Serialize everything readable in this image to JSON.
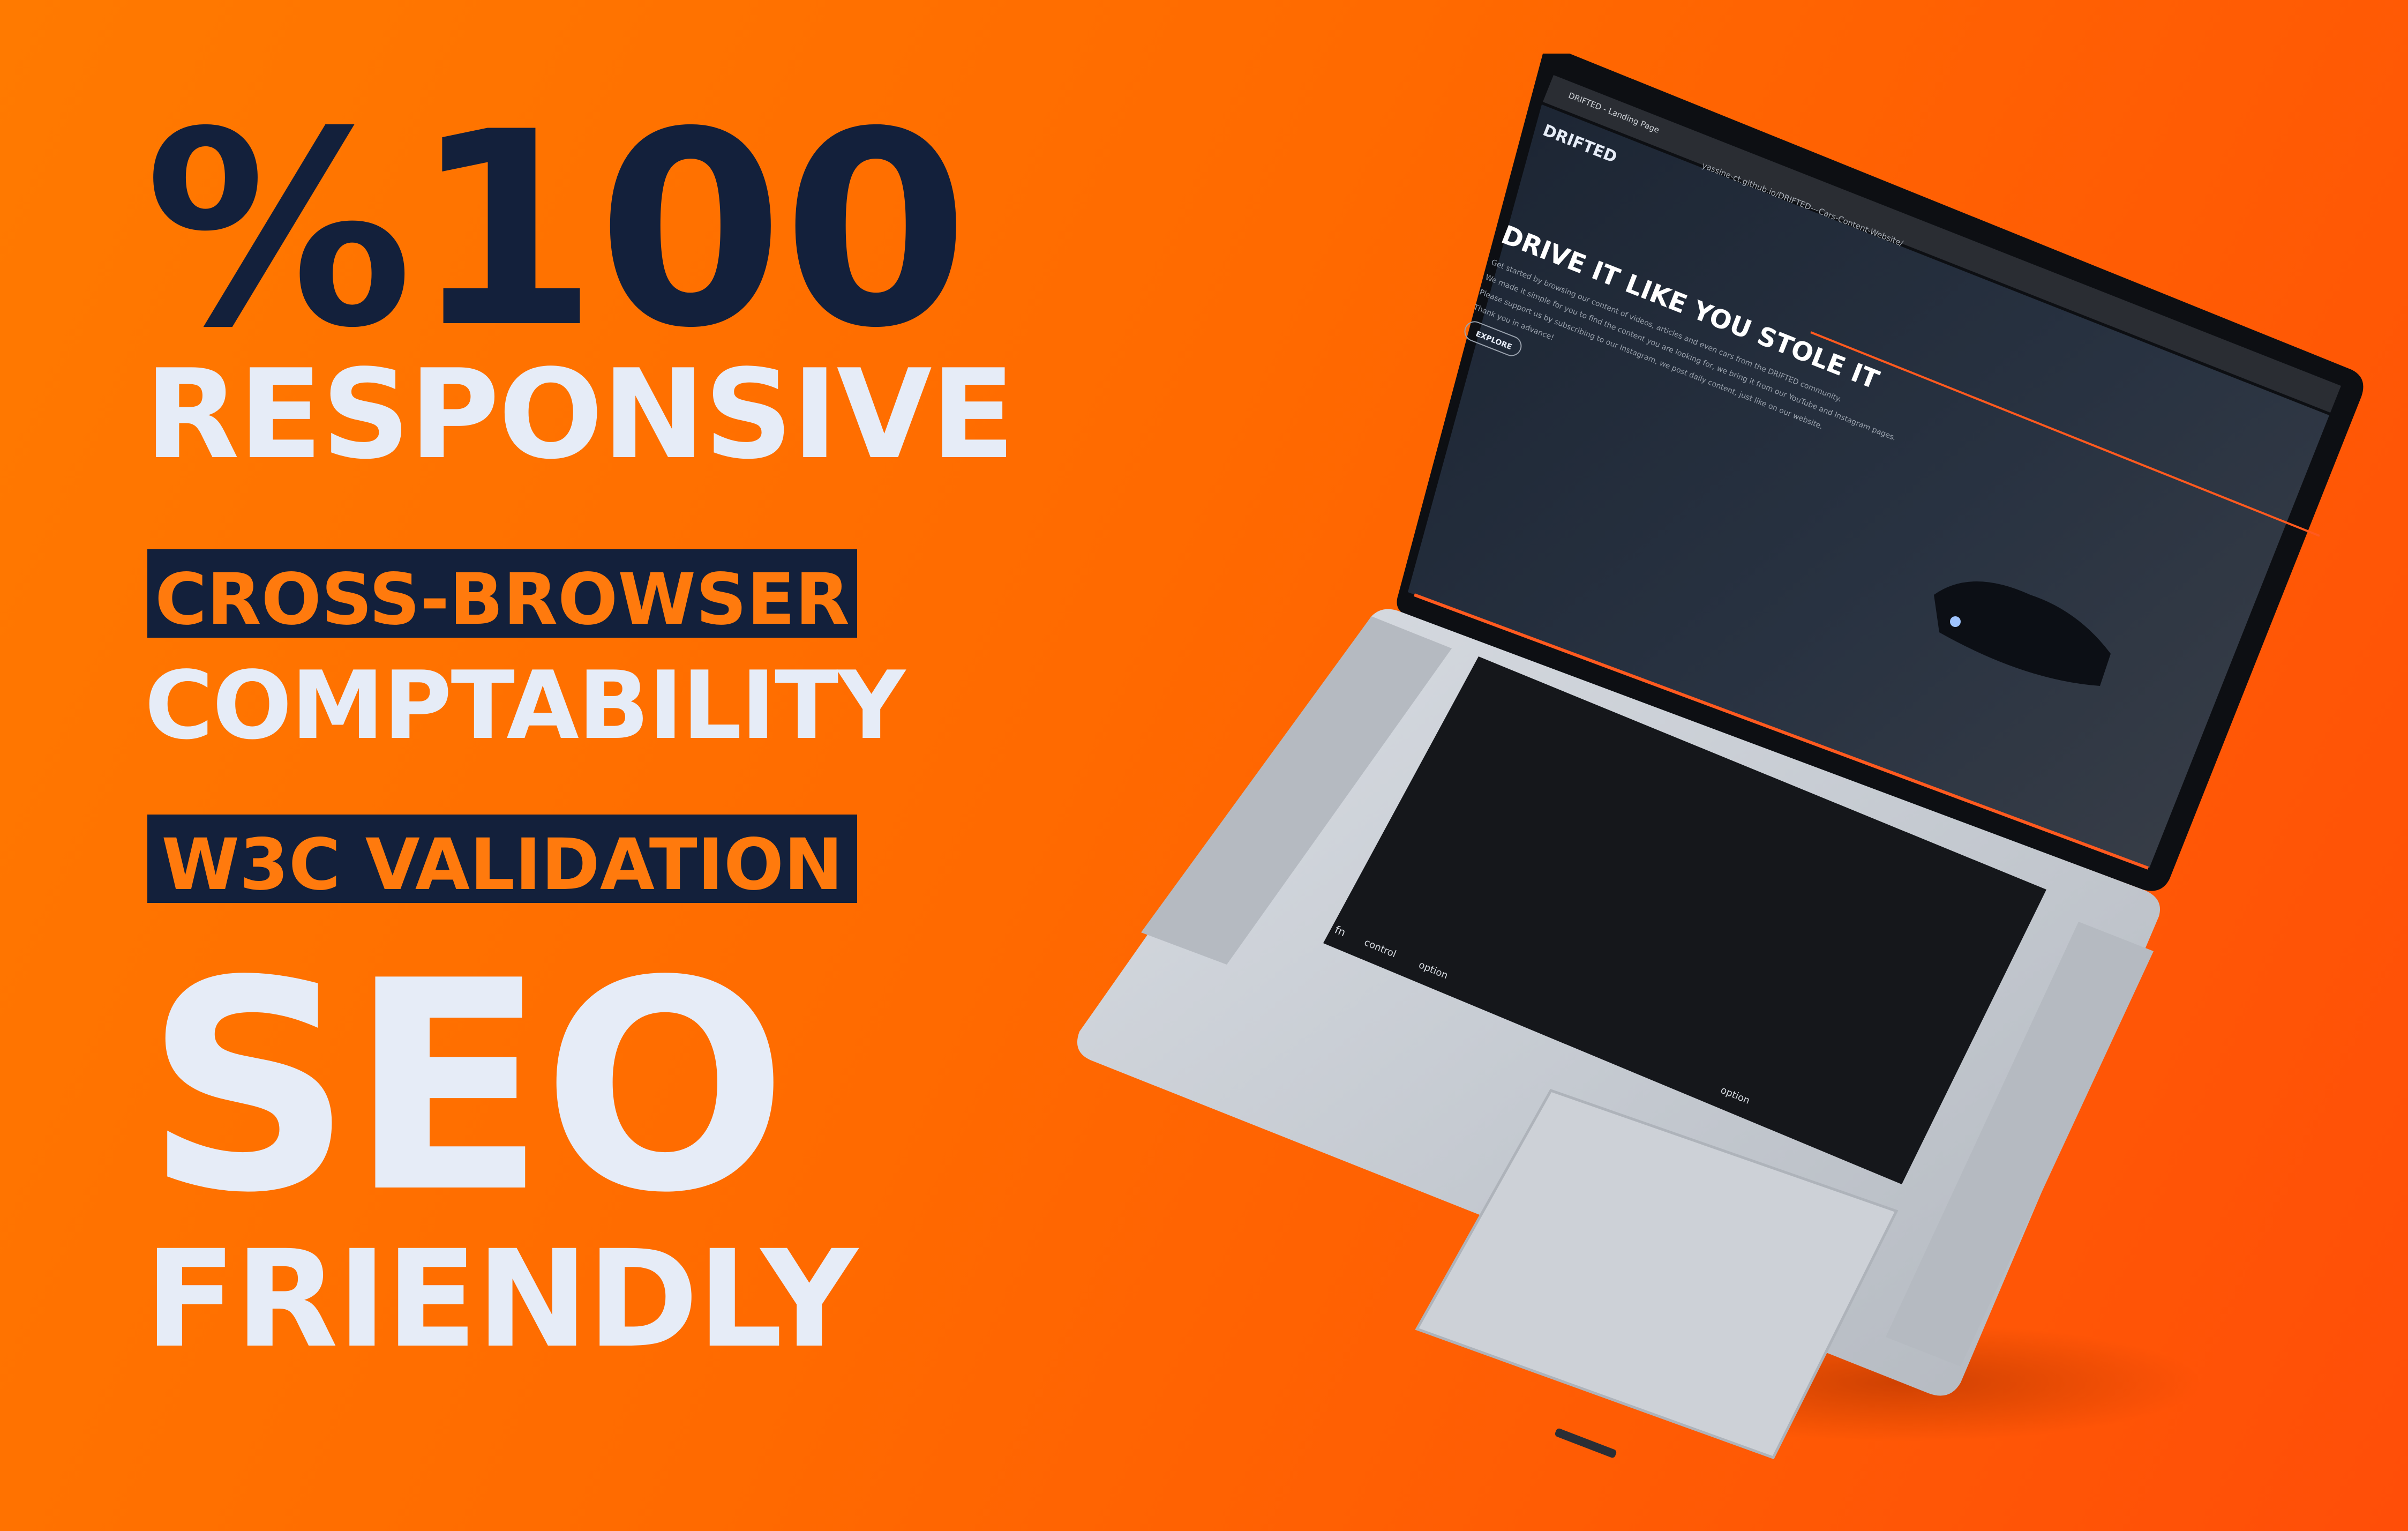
{
  "headline": {
    "percent": "%100",
    "responsive": "RESPONSIVE",
    "cross_browser": "CROSS-BROWSER",
    "compatibility": "COMPTABILITY",
    "w3c": "W3C VALIDATION",
    "seo": "SEO",
    "friendly": "FRIENDLY"
  },
  "browser": {
    "tab_title": "DRIFTED - Landing Page",
    "url": "yassine-ct.github.io/DRIFTED---Cars-Content-Website/"
  },
  "site": {
    "logo": "DRIFTED",
    "hero_title": "DRIVE IT LIKE YOU STOLE IT",
    "paragraph1": "Get started by browsing our content of videos, articles and even cars from the DRIFTED community.",
    "paragraph2": "We made it simple for you to find the content you are looking for, we bring it from our YouTube and Instagram pages.",
    "paragraph3": "Please support us by subscribing to our Instagram, we post daily content, just like on our website.",
    "thanks": "Thank you in advance!",
    "explore_button": "EXPLORE"
  },
  "keyboard": {
    "fn": "fn",
    "control": "control",
    "option_left": "option",
    "option_right": "option"
  },
  "colors": {
    "background": "#ff6a00",
    "navy": "#13203b",
    "light_text": "#e6ecf7",
    "accent_orange": "#ff7a0d"
  }
}
